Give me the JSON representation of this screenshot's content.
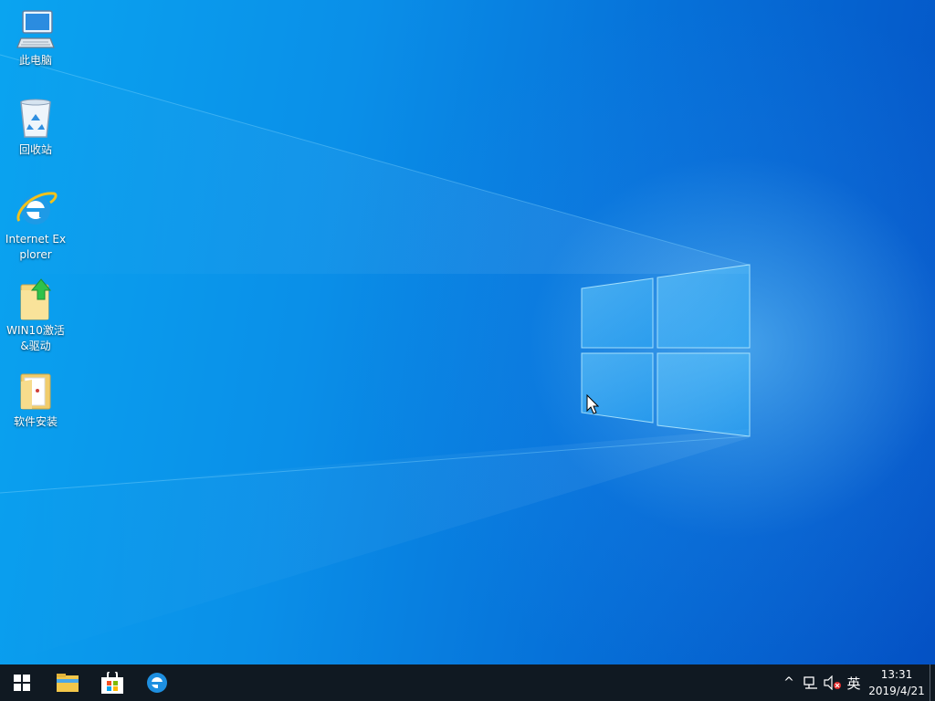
{
  "desktop": {
    "icons": [
      {
        "label": "此电脑",
        "icon": "computer-icon"
      },
      {
        "label": "回收站",
        "icon": "recycle-bin-icon"
      },
      {
        "label": "Internet Explorer",
        "icon": "internet-explorer-icon"
      },
      {
        "label": "WIN10激活&驱动",
        "icon": "folder-with-arrow-icon"
      },
      {
        "label": "软件安装",
        "icon": "folder-icon"
      }
    ]
  },
  "taskbar": {
    "pinned": [
      "start-icon",
      "file-explorer-icon",
      "store-icon",
      "edge-icon"
    ],
    "tray": {
      "chevron": "^",
      "network": "network-icon",
      "volume": "volume-muted-icon",
      "ime": "英"
    },
    "clock": {
      "time": "13:31",
      "date": "2019/4/21"
    }
  },
  "colors": {
    "taskbar_bg": "#101922",
    "wallpaper_blue": "#0a8fe8"
  }
}
